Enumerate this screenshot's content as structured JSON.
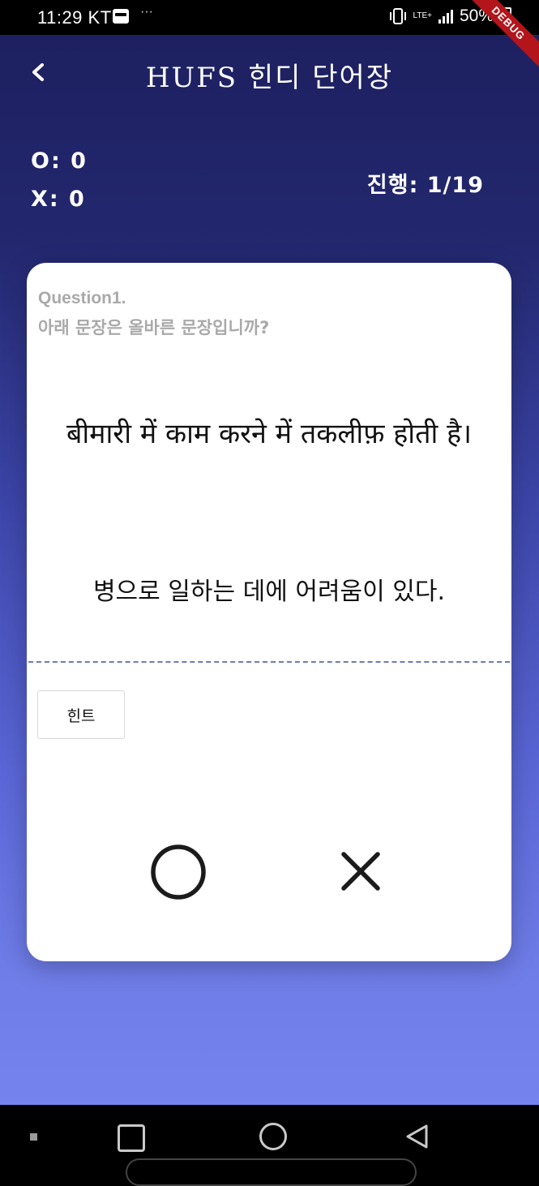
{
  "status_bar": {
    "time": "11:29 KT",
    "overflow": "···",
    "network": "LTE+",
    "battery": "50%",
    "debug_banner": "DEBUG"
  },
  "header": {
    "title": "HUFS 힌디 단어장",
    "back_icon": "chevron-left-icon"
  },
  "score": {
    "correct": "O: 0",
    "wrong": "X: 0",
    "progress": "진행: 1/19"
  },
  "card": {
    "question_number": "Question1.",
    "question_prompt": "아래 문장은 올바른 문장입니까?",
    "hindi_sentence": "बीमारी में काम करने में तकलीफ़ होती है।",
    "korean_translation": "병으로 일하는 데에 어려움이 있다.",
    "hint_label": "힌트",
    "correct_icon": "circle-o-icon",
    "wrong_icon": "x-icon"
  },
  "nav_bar": {
    "icons": [
      "recents-icon",
      "home-icon",
      "back-icon"
    ]
  },
  "colors": {
    "gradient_top": "#1c1f5e",
    "gradient_bottom": "#7583ef",
    "divider": "#6f7aba"
  }
}
